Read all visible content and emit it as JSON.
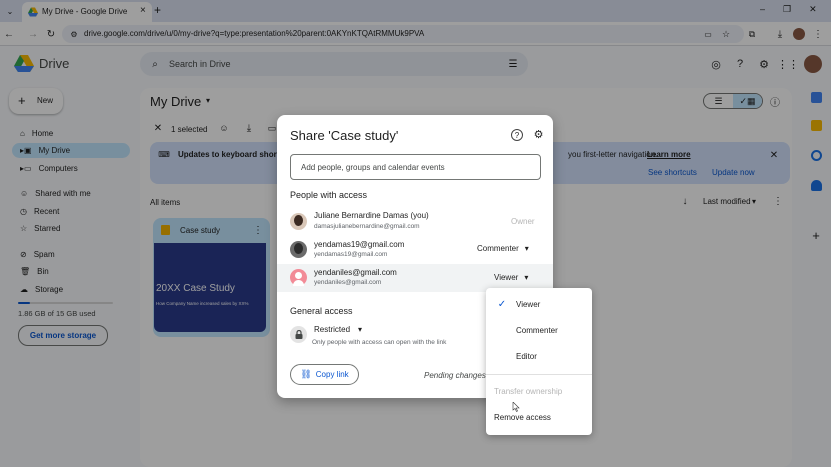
{
  "browser": {
    "tab_title": "My Drive - Google Drive",
    "new_tab_symbol": "+",
    "close_tab_symbol": "×",
    "url": "drive.google.com/drive/u/0/my-drive?q=type:presentation%20parent:0AKYnKTQAtRMMUk9PVA",
    "window_controls": [
      "–",
      "❐",
      "✕"
    ]
  },
  "drive": {
    "logo_text": "Drive",
    "search_placeholder": "Search in Drive",
    "new_button": "New",
    "nav": [
      {
        "label": "Home",
        "icon": "home-icon"
      },
      {
        "label": "My Drive",
        "icon": "drive-icon",
        "active": true
      },
      {
        "label": "Computers",
        "icon": "computer-icon"
      },
      {
        "label": "Shared with me",
        "icon": "people-icon"
      },
      {
        "label": "Recent",
        "icon": "clock-icon"
      },
      {
        "label": "Starred",
        "icon": "star-icon"
      },
      {
        "label": "Spam",
        "icon": "spam-icon"
      },
      {
        "label": "Bin",
        "icon": "trash-icon"
      },
      {
        "label": "Storage",
        "icon": "cloud-icon"
      }
    ],
    "storage_text": "1.86 GB of 15 GB used",
    "storage_fraction": 0.124,
    "get_storage": "Get more storage",
    "page_title": "My Drive",
    "selection_text": "1 selected",
    "banner_left": "Updates to keyboard shortc",
    "banner_right": "you first-letter navigation.",
    "banner_learn": "Learn more",
    "banner_see": "See shortcuts",
    "banner_update": "Update now",
    "all_items": "All items",
    "sort_label": "Last modified",
    "file_name": "Case study",
    "thumb_title": "20XX Case Study",
    "thumb_sub": "How Company Name increased sales by XX%"
  },
  "share_dialog": {
    "title": "Share 'Case study'",
    "add_placeholder": "Add people, groups and calendar events",
    "people_heading": "People with access",
    "people": [
      {
        "name": "Juliane Bernardine Damas (you)",
        "email": "damasjulianebernardine@gmail.com",
        "role": "Owner"
      },
      {
        "name": "yendamas19@gmail.com",
        "email": "yendamas19@gmail.com",
        "role": "Commenter"
      },
      {
        "name": "yendaniles@gmail.com",
        "email": "yendaniles@gmail.com",
        "role": "Viewer"
      }
    ],
    "general_heading": "General access",
    "restricted_label": "Restricted",
    "restricted_desc": "Only people with access can open with the link",
    "copy_link": "Copy link",
    "pending": "Pending changes"
  },
  "role_menu": {
    "items": [
      {
        "label": "Viewer",
        "selected": true
      },
      {
        "label": "Commenter"
      },
      {
        "label": "Editor"
      }
    ],
    "transfer": "Transfer ownership",
    "remove": "Remove access"
  },
  "colors": {
    "accent": "#0b57d0",
    "active_nav": "#c2e7ff",
    "banner": "#d3e3fd"
  }
}
